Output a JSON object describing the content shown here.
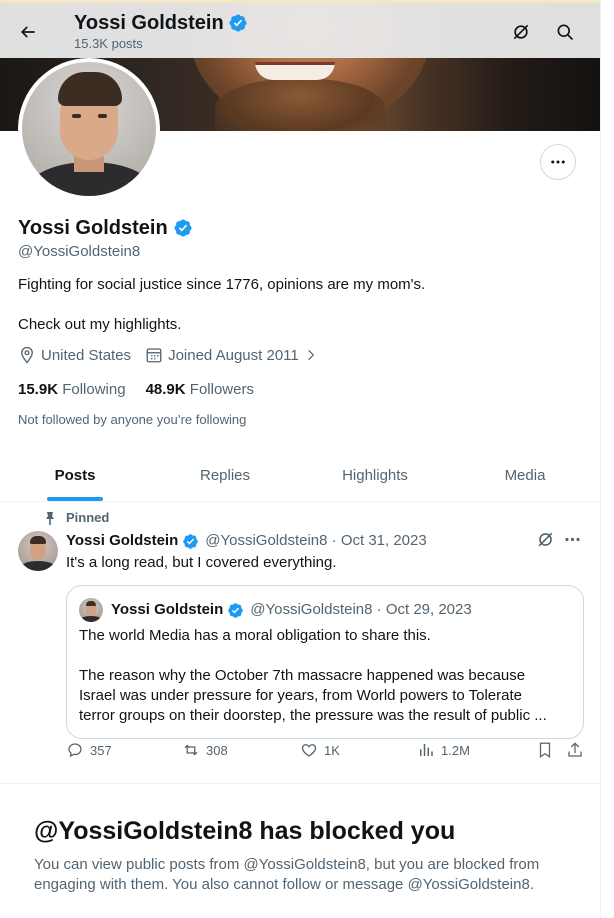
{
  "header": {
    "name": "Yossi Goldstein",
    "posts_count": "15.3K posts",
    "back_icon": "arrow-left-icon",
    "grok_icon": "grok-icon",
    "search_icon": "search-icon"
  },
  "profile": {
    "name": "Yossi Goldstein",
    "handle": "@YossiGoldstein8",
    "verified": true,
    "bio_line1": "Fighting for social justice since 1776, opinions are my mom's.",
    "bio_line2": "Check out my highlights.",
    "location": "United States",
    "joined": "Joined August 2011",
    "following_count": "15.9K",
    "following_label": "Following",
    "followers_count": "48.9K",
    "followers_label": "Followers",
    "not_followed": "Not followed by anyone you’re following"
  },
  "tabs": [
    {
      "label": "Posts",
      "active": true
    },
    {
      "label": "Replies",
      "active": false
    },
    {
      "label": "Highlights",
      "active": false
    },
    {
      "label": "Media",
      "active": false
    }
  ],
  "tweet": {
    "pinned_label": "Pinned",
    "name": "Yossi Goldstein",
    "handle_date": "@YossiGoldstein8 · Oct 31, 2023",
    "text": "It's a long read, but I covered everything.",
    "quote": {
      "name": "Yossi Goldstein",
      "handle_date": "@YossiGoldstein8 · Oct 29, 2023",
      "para1": "The world Media has a moral obligation to share this.",
      "para2_line1": "The reason why the October 7th massacre happened was because",
      "para2_line2": "Israel was under pressure for years, from World powers to Tolerate",
      "para2_line3": "terror groups on their doorstep, the pressure was the result of public ..."
    },
    "replies": "357",
    "reposts": "308",
    "likes": "1K",
    "views": "1.2M"
  },
  "blocked": {
    "title": "@YossiGoldstein8 has blocked you",
    "message": "You can view public posts from @YossiGoldstein8, but you are blocked from engaging with them. You also cannot follow or message @YossiGoldstein8."
  },
  "colors": {
    "accent": "#1d9bf0",
    "text": "#0f1419",
    "secondary": "#536471",
    "border": "#cfd9de"
  }
}
